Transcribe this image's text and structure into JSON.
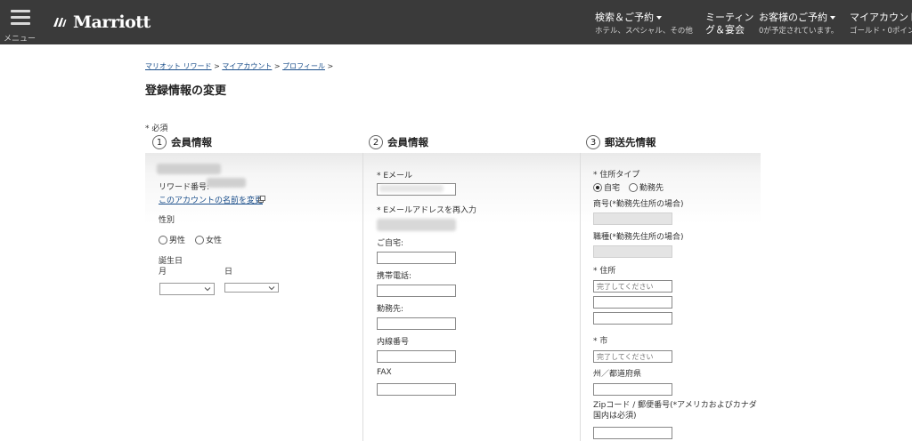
{
  "header": {
    "menu_label": "メニュー",
    "logo_text": "Marriott",
    "nav": [
      {
        "main": "検索＆ご予約",
        "sub": "ホテル、スペシャル、その他"
      },
      {
        "main": "ミーティン",
        "sub": "グ＆宴会"
      },
      {
        "main": "お客様のご予約",
        "sub": "0が予定されています。"
      },
      {
        "main": "マイアカウント",
        "sub": "ゴールド・0ポイン"
      }
    ]
  },
  "breadcrumb": {
    "items": [
      "マリオット リワード",
      "マイアカウント",
      "プロフィール"
    ],
    "separator": ">"
  },
  "page_title": "登録情報の変更",
  "required_note": "* 必須",
  "sections": [
    {
      "num": "1",
      "title": "会員情報"
    },
    {
      "num": "2",
      "title": "会員情報"
    },
    {
      "num": "3",
      "title": "郵送先情報"
    }
  ],
  "col1": {
    "rewards_label": "リワード番号:",
    "rename_link": "このアカウントの名前を変更",
    "gender_label": "性別",
    "male": "男性",
    "female": "女性",
    "birthday_label": "誕生日",
    "month_label": "月",
    "day_label": "日"
  },
  "col2": {
    "email_label": "* Eメール",
    "email_confirm_label": "* Eメールアドレスを再入力",
    "home_label": "ご自宅:",
    "mobile_label": "携帯電話:",
    "work_label": "勤務先:",
    "extension_label": "内線番号",
    "fax_label": "FAX"
  },
  "col3": {
    "address_type_label": "* 住所タイプ",
    "home_option": "自宅",
    "work_option": "勤務先",
    "company_label": "商号(*勤務先住所の場合)",
    "industry_label": "職種(*勤務先住所の場合)",
    "address_label": "* 住所",
    "address_placeholder": "完了してください",
    "city_label": "* 市",
    "city_placeholder": "完了してください",
    "state_label": "州／都道府県",
    "zip_label": "Zipコード / 郵便番号(*アメリカおよびカナダ国内は必須)"
  }
}
